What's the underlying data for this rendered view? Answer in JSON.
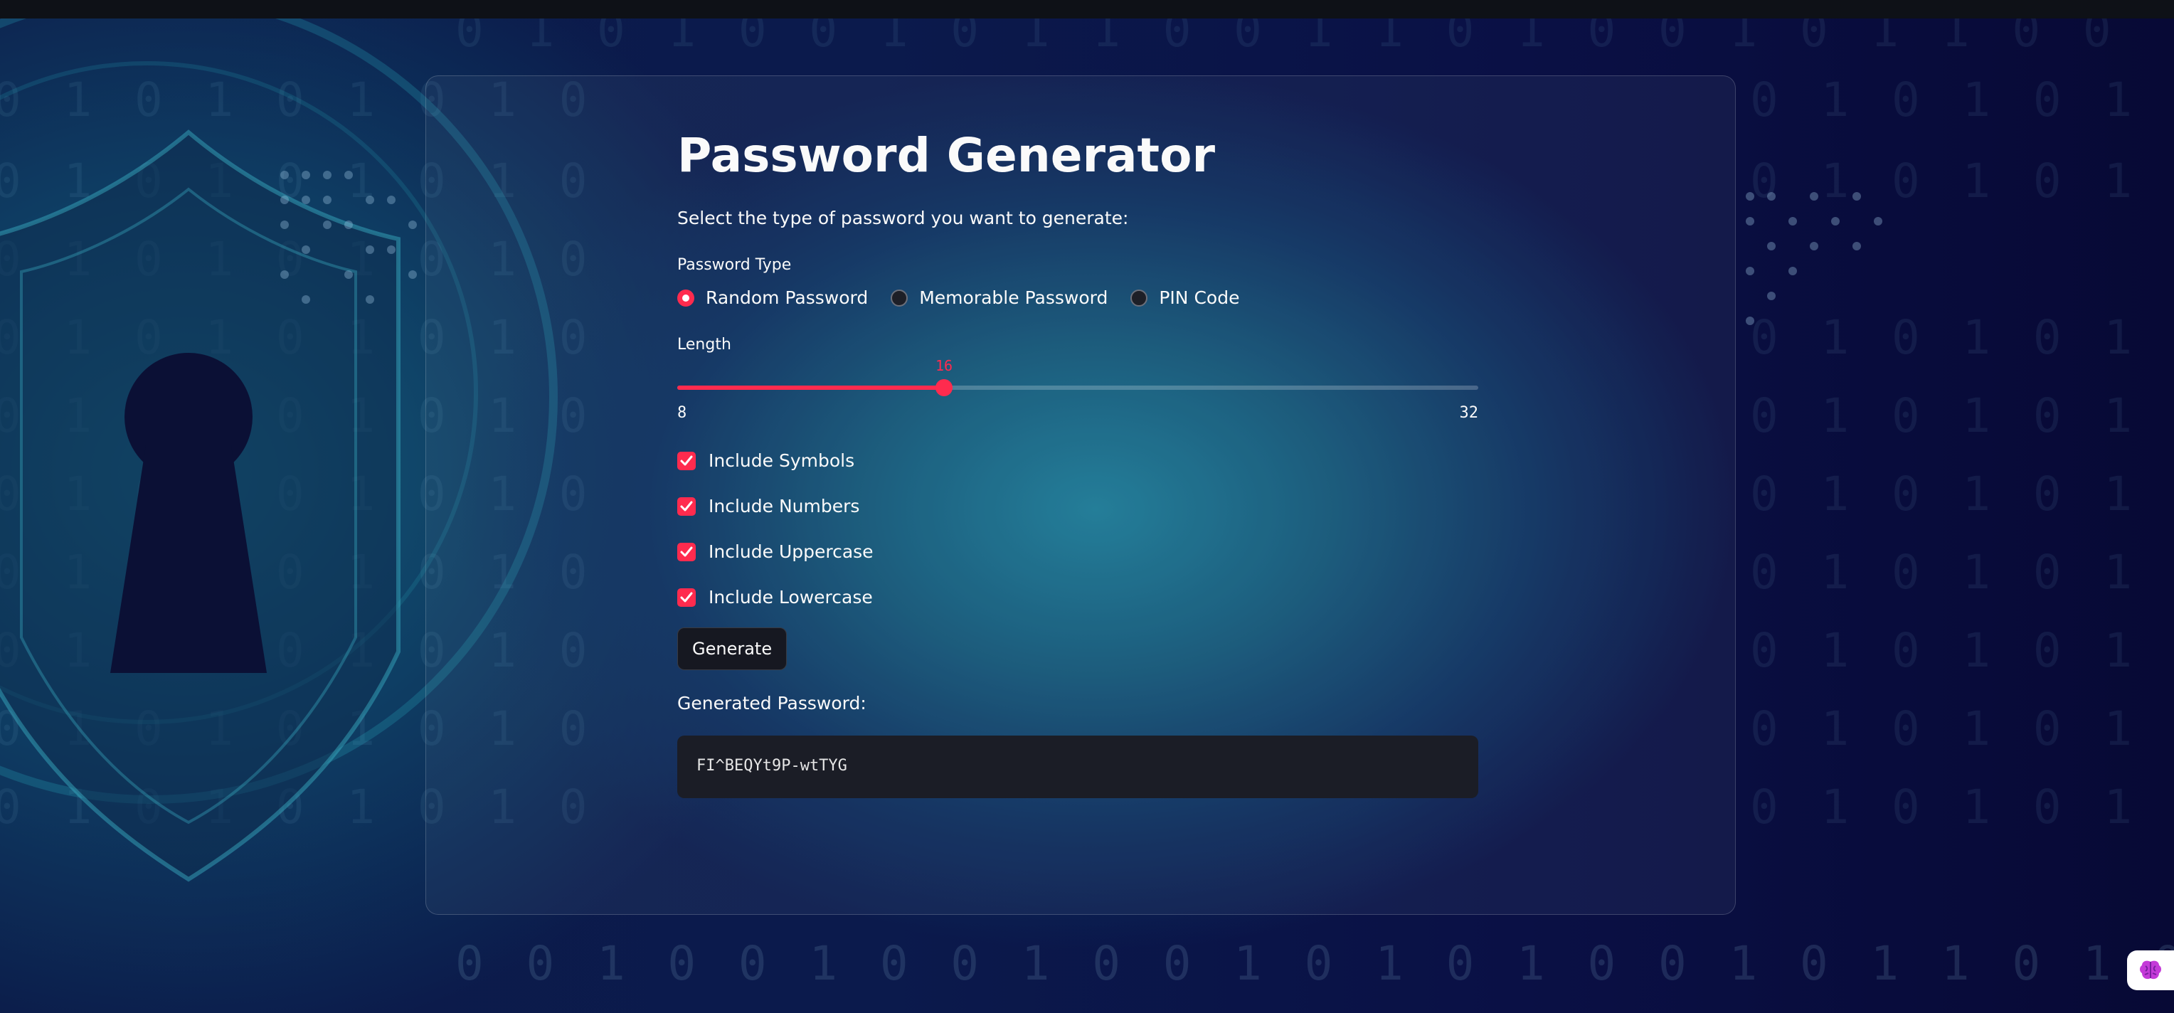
{
  "app": {
    "title": "Password Generator",
    "subtitle": "Select the type of password you want to generate:"
  },
  "password_type": {
    "label": "Password Type",
    "options": [
      "Random Password",
      "Memorable Password",
      "PIN Code"
    ],
    "selected": "Random Password"
  },
  "length": {
    "label": "Length",
    "value": "16",
    "min": "8",
    "max": "32",
    "fraction": 0.333
  },
  "options": {
    "symbols": {
      "label": "Include Symbols",
      "checked": true
    },
    "numbers": {
      "label": "Include Numbers",
      "checked": true
    },
    "uppercase": {
      "label": "Include Uppercase",
      "checked": true
    },
    "lowercase": {
      "label": "Include Lowercase",
      "checked": true
    }
  },
  "actions": {
    "generate_label": "Generate"
  },
  "result": {
    "label": "Generated Password:",
    "value": "FI^BEQYt9P-wtTYG"
  },
  "colors": {
    "accent": "#ff2b4e",
    "card_bg": "rgba(120,140,170,0.10)",
    "code_bg": "#1b1d26"
  },
  "icons": {
    "corner": "brain-icon",
    "check": "checkmark-icon"
  }
}
